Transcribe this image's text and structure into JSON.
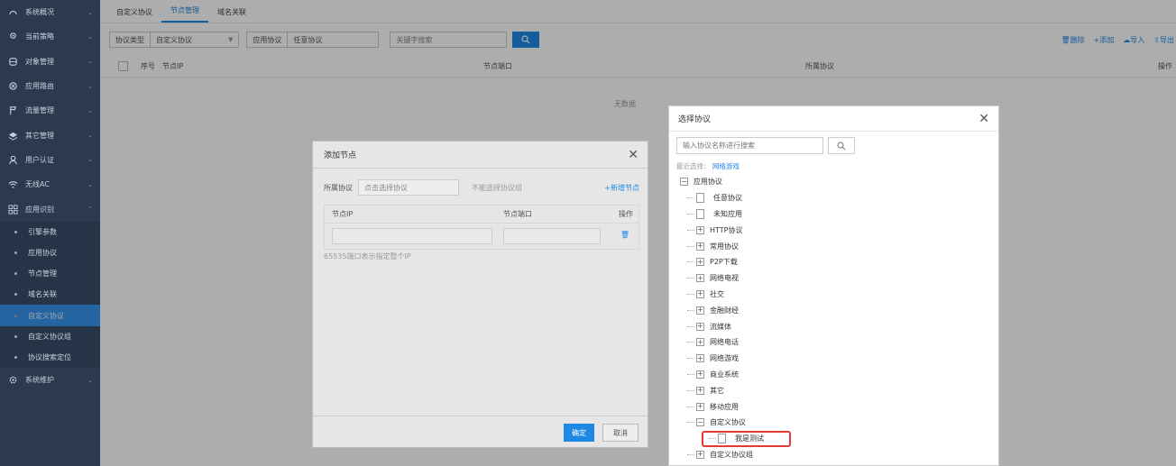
{
  "sidebar": {
    "items": [
      {
        "label": "系统概况",
        "icon": "dashboard-icon"
      },
      {
        "label": "当前策略",
        "icon": "location-pin-icon"
      },
      {
        "label": "对象管理",
        "icon": "database-icon"
      },
      {
        "label": "应用路由",
        "icon": "route-icon"
      },
      {
        "label": "流量管理",
        "icon": "flag-icon"
      },
      {
        "label": "其它管理",
        "icon": "layers-icon"
      },
      {
        "label": "用户认证",
        "icon": "user-icon"
      },
      {
        "label": "无线AC",
        "icon": "wifi-icon"
      },
      {
        "label": "应用识别",
        "icon": "grid-icon"
      }
    ],
    "subitems": [
      "引擎参数",
      "应用协议",
      "节点管理",
      "域名关联",
      "自定义协议",
      "自定义协议组",
      "协议搜索定位"
    ],
    "last_item": {
      "label": "系统维护",
      "icon": "gear-icon"
    }
  },
  "tabs": [
    "自定义协议",
    "节点管理",
    "域名关联"
  ],
  "toolbar": {
    "protocol_type_label": "协议类型",
    "protocol_type_value": "自定义协议",
    "app_protocol_label": "应用协议",
    "app_protocol_value": "任意协议",
    "keyword_placeholder": "关键字搜索",
    "delete": "删除",
    "add": "+添加",
    "import": "导入",
    "export": "导出"
  },
  "table": {
    "columns": [
      "序号",
      "节点IP",
      "节点端口",
      "所属协议",
      "操作"
    ],
    "empty_text": "无数据"
  },
  "add_node_modal": {
    "title": "添加节点",
    "protocol_label": "所属协议",
    "protocol_placeholder": "点击选择协议",
    "hint_no_group": "不能选择协议组",
    "add_node": "+新增节点",
    "col_ip": "节点IP",
    "col_port": "节点端口",
    "col_action": "操作",
    "note": "65535端口表示指定整个IP",
    "ok": "确定",
    "cancel": "取消"
  },
  "select_protocol_modal": {
    "title": "选择协议",
    "search_placeholder": "输入协议名称进行搜索",
    "recent_label": "最近选择：",
    "recent_value": "网络游戏",
    "root": "应用协议",
    "tree": [
      {
        "label": "任意协议",
        "type": "leaf"
      },
      {
        "label": "未知应用",
        "type": "leaf"
      },
      {
        "label": "HTTP协议",
        "type": "folder"
      },
      {
        "label": "常用协议",
        "type": "folder"
      },
      {
        "label": "P2P下载",
        "type": "folder"
      },
      {
        "label": "网络电视",
        "type": "folder"
      },
      {
        "label": "社交",
        "type": "folder"
      },
      {
        "label": "金融财经",
        "type": "folder"
      },
      {
        "label": "流媒体",
        "type": "folder"
      },
      {
        "label": "网络电话",
        "type": "folder"
      },
      {
        "label": "网络游戏",
        "type": "folder"
      },
      {
        "label": "商业系统",
        "type": "folder"
      },
      {
        "label": "其它",
        "type": "folder"
      },
      {
        "label": "移动应用",
        "type": "folder"
      },
      {
        "label": "自定义协议",
        "type": "open"
      },
      {
        "label": "我是测试",
        "type": "child"
      },
      {
        "label": "自定义协议组",
        "type": "folder"
      }
    ]
  },
  "colors": {
    "accent": "#1e88e5",
    "sidebar_bg": "#2c3a4f",
    "highlight_border": "#e53935"
  }
}
